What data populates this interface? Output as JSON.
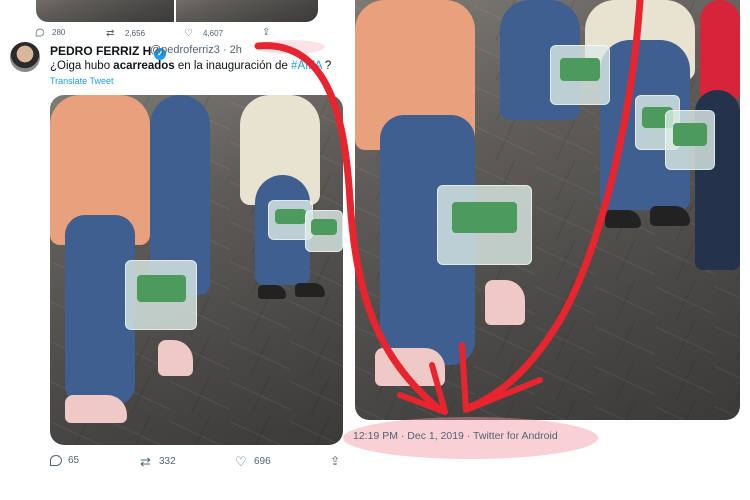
{
  "top_actions": {
    "replies": "280",
    "retweets": "2,656",
    "likes": "4,607"
  },
  "tweet": {
    "author_name": "PEDRO FERRIZ H",
    "handle_time": "@pedroferriz3 · 2h",
    "text_before": "¿Oiga hubo ",
    "text_bold": "acarreados",
    "text_middle": " en la inauguración de ",
    "hashtag": "#AIFA",
    "text_after": " ?",
    "translate": "Translate Tweet"
  },
  "bottom_actions": {
    "replies": "65",
    "retweets": "332",
    "likes": "696"
  },
  "source_tweet": {
    "timestamp": "12:19 PM · Dec 1, 2019 · Twitter for Android"
  },
  "colors": {
    "arrow": "#e8252e",
    "highlight": "#f096a5",
    "link": "#1d9bf0",
    "muted": "#536471"
  },
  "icons": [
    "reply-icon",
    "retweet-icon",
    "like-icon",
    "share-icon",
    "verified-icon"
  ]
}
